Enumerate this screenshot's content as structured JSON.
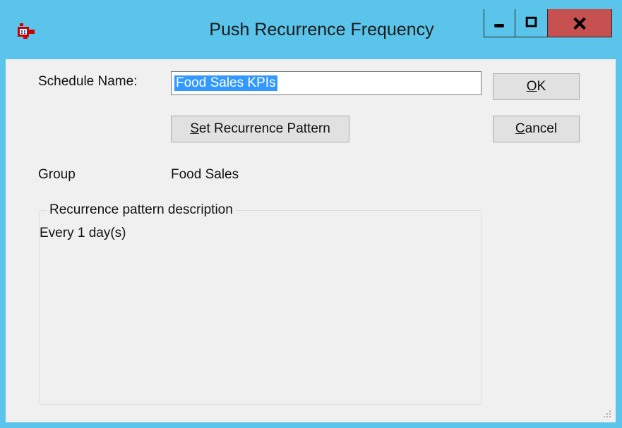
{
  "window": {
    "title": "Push Recurrence Frequency",
    "icon": "app-icon",
    "controls": [
      "minimize-icon",
      "maximize-icon",
      "close-icon"
    ]
  },
  "form": {
    "schedule_name_label": "Schedule Name:",
    "schedule_name_value": "Food Sales KPIs",
    "set_pattern_button": {
      "mnemonic": "S",
      "rest": "et Recurrence Pattern"
    },
    "group_label": "Group",
    "group_value": "Food Sales",
    "groupbox_caption": "Recurrence pattern description",
    "description_text": "Every 1 day(s)"
  },
  "buttons": {
    "ok": {
      "mnemonic": "O",
      "rest": "K"
    },
    "cancel": {
      "mnemonic": "C",
      "rest": "ancel"
    }
  },
  "colors": {
    "titlebar": "#5bc4ea",
    "close_button": "#c75050",
    "client": "#f0f0f0",
    "selection": "#3399ff"
  }
}
